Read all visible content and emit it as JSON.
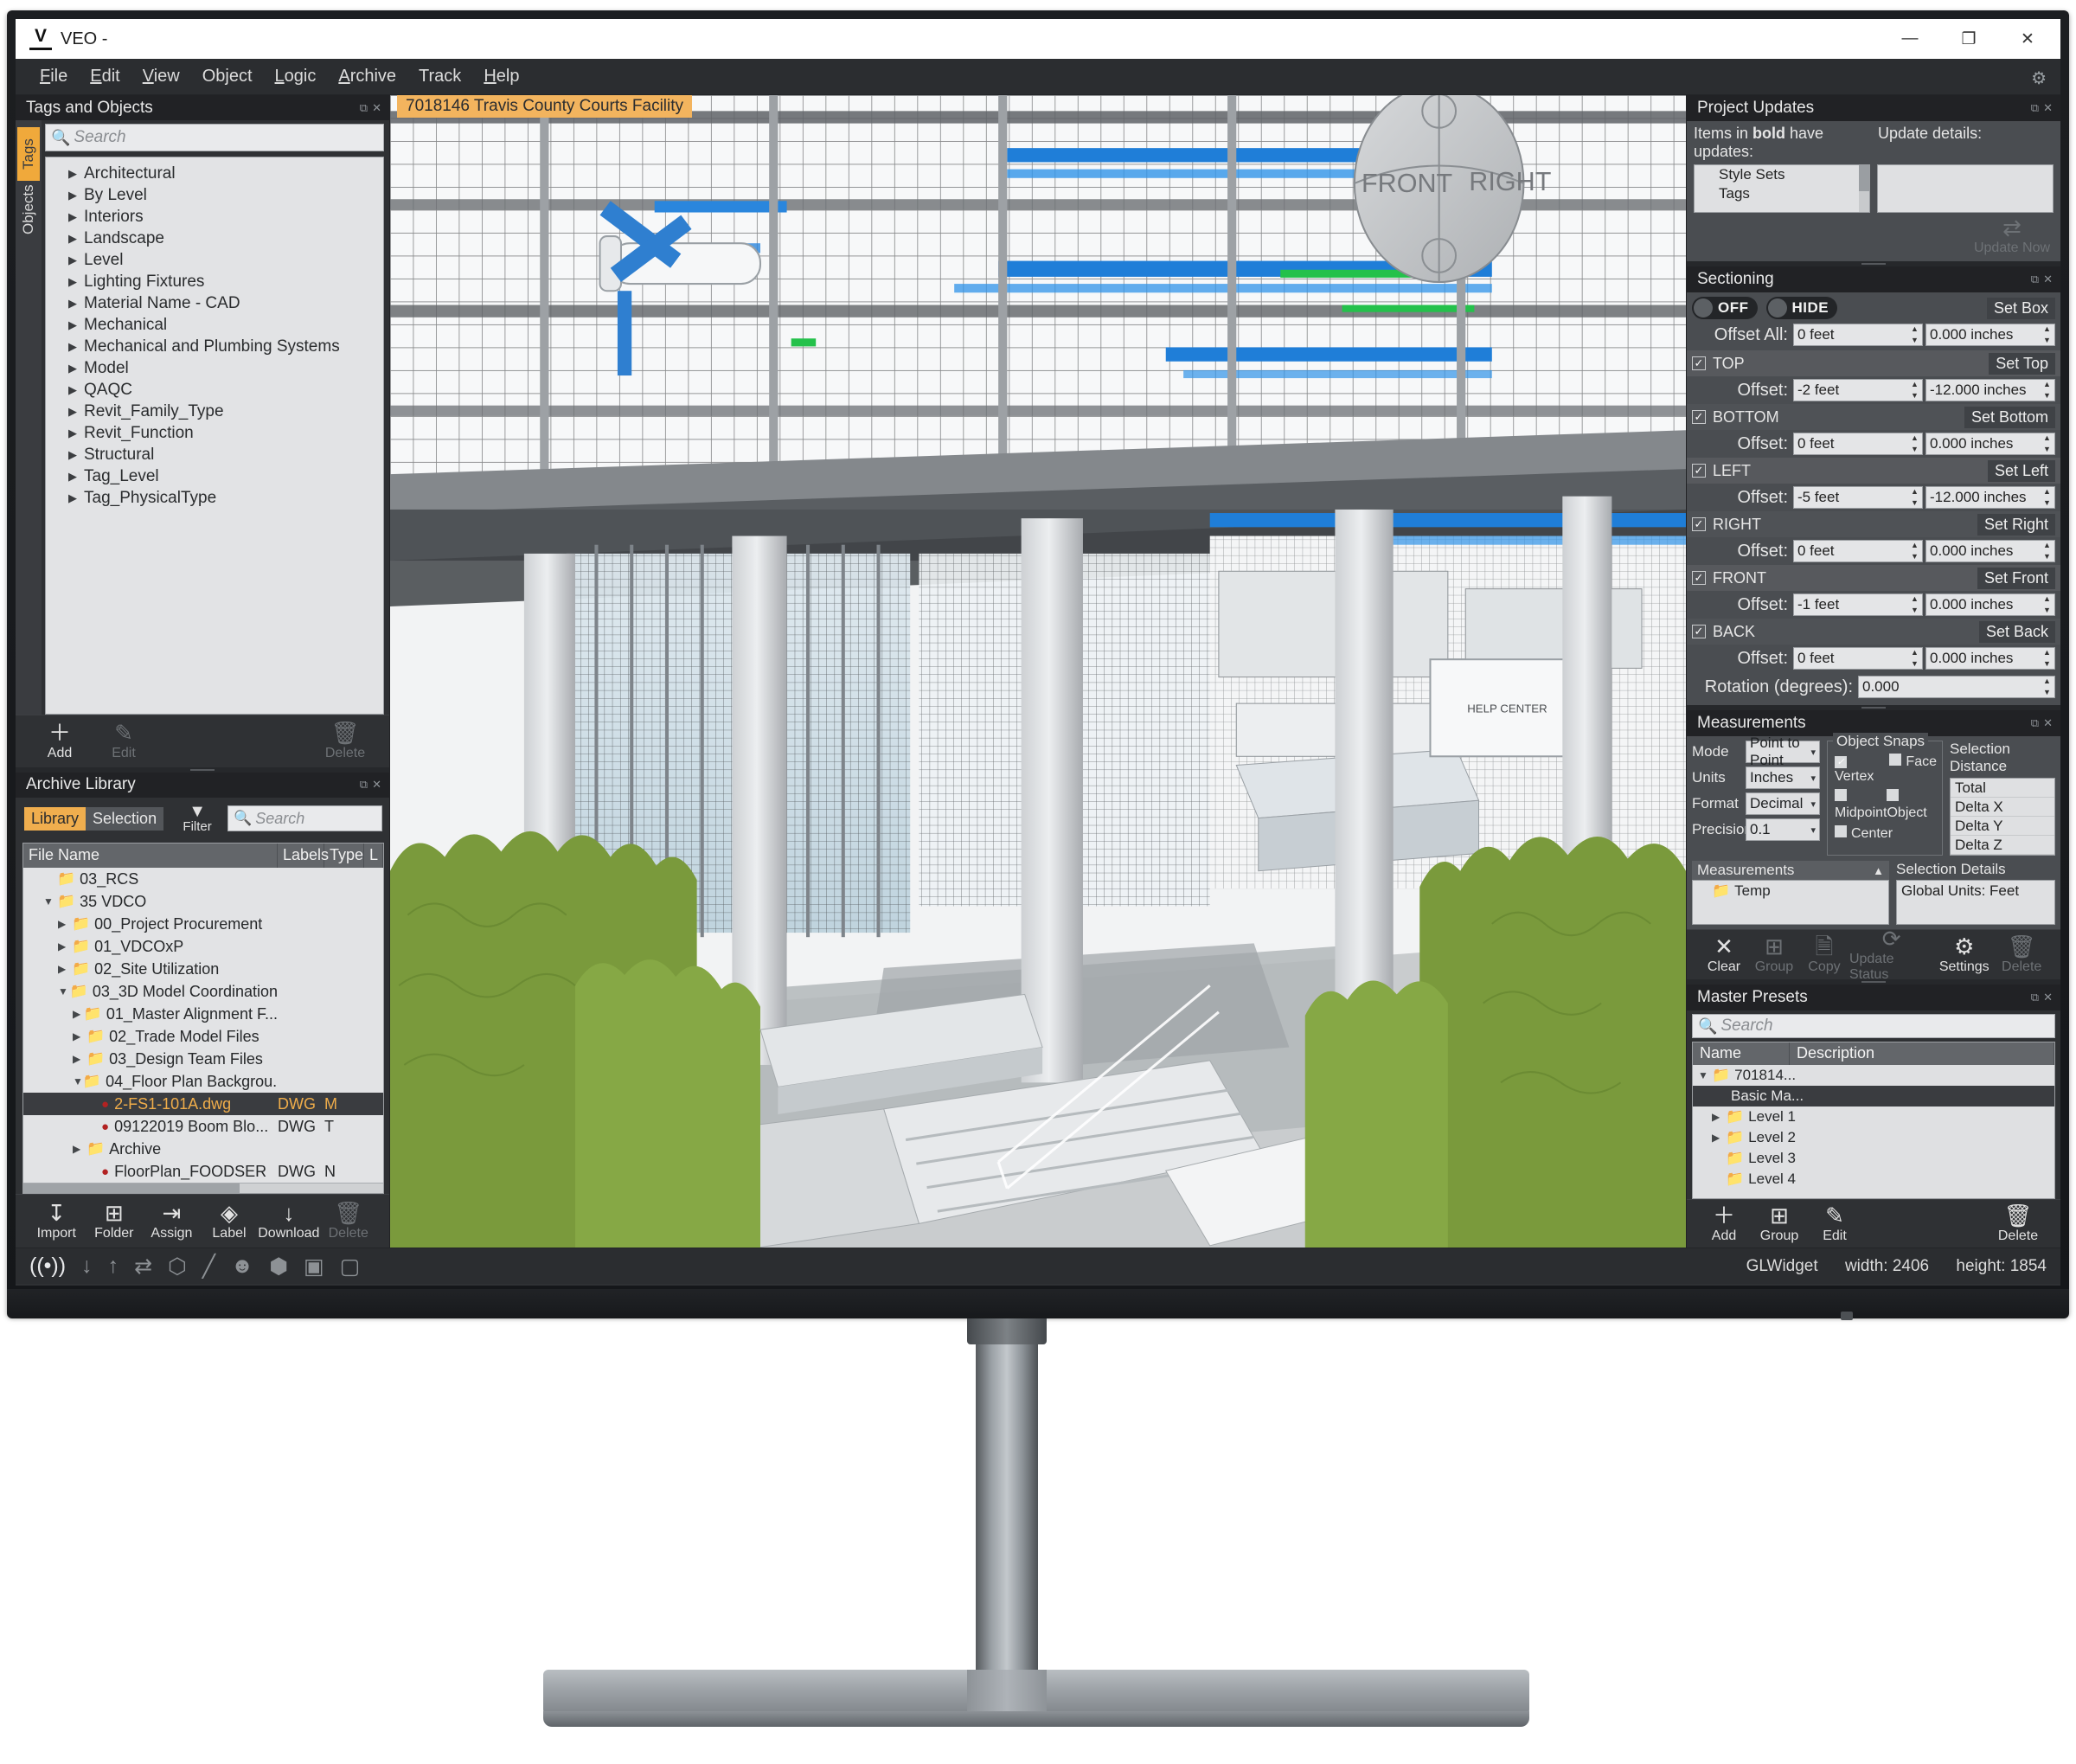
{
  "window": {
    "title": "VEO -",
    "logo": "V",
    "minimize": "—",
    "maximize": "❐",
    "close": "✕"
  },
  "menubar": {
    "items": [
      "File",
      "Edit",
      "View",
      "Object",
      "Logic",
      "Archive",
      "Track",
      "Help"
    ],
    "gear_icon": "gear-icon"
  },
  "tags_panel": {
    "title": "Tags and Objects",
    "dock_icons": [
      "⧉",
      "✕"
    ],
    "vtabs": [
      {
        "label": "Tags",
        "active": true
      },
      {
        "label": "Objects",
        "active": false
      }
    ],
    "search_placeholder": "Search",
    "tree": [
      "Architectural",
      "By Level",
      "Interiors",
      "Landscape",
      "Level",
      "Lighting Fixtures",
      "Material Name - CAD",
      "Mechanical",
      "Mechanical and Plumbing Systems",
      "Model",
      "QAQC",
      "Revit_Family_Type",
      "Revit_Function",
      "Structural",
      "Tag_Level",
      "Tag_PhysicalType"
    ],
    "toolbar": [
      {
        "icon": "plus-icon",
        "glyph": "＋",
        "label": "Add",
        "enabled": true
      },
      {
        "icon": "pencil-icon",
        "glyph": "✎",
        "label": "Edit",
        "enabled": false
      },
      {
        "icon": "trash-icon",
        "glyph": "🗑",
        "label": "Delete",
        "enabled": false
      }
    ]
  },
  "archive_panel": {
    "title": "Archive Library",
    "dock_icons": [
      "⧉",
      "✕"
    ],
    "tabs": [
      {
        "label": "Library",
        "active": true
      },
      {
        "label": "Selection",
        "active": false
      }
    ],
    "filter_label": "Filter",
    "filter_icon": "funnel-icon",
    "search_placeholder": "Search",
    "columns": [
      "File Name",
      "Labels",
      "Type",
      "L"
    ],
    "rows": [
      {
        "indent": 1,
        "arrow": "",
        "kind": "folder",
        "name": "03_RCS",
        "labels": "",
        "type": "",
        "selected": false
      },
      {
        "indent": 1,
        "arrow": "▼",
        "kind": "folder",
        "name": "35 VDCO",
        "labels": "",
        "type": "",
        "selected": false
      },
      {
        "indent": 2,
        "arrow": "▶",
        "kind": "folder",
        "name": "00_Project Procurement",
        "labels": "",
        "type": "",
        "selected": false
      },
      {
        "indent": 2,
        "arrow": "▶",
        "kind": "folder",
        "name": "01_VDCOxP",
        "labels": "",
        "type": "",
        "selected": false
      },
      {
        "indent": 2,
        "arrow": "▶",
        "kind": "folder",
        "name": "02_Site Utilization",
        "labels": "",
        "type": "",
        "selected": false
      },
      {
        "indent": 2,
        "arrow": "▼",
        "kind": "folder",
        "name": "03_3D Model Coordination",
        "labels": "",
        "type": "",
        "selected": false
      },
      {
        "indent": 3,
        "arrow": "▶",
        "kind": "folder",
        "name": "01_Master Alignment F...",
        "labels": "",
        "type": "",
        "selected": false
      },
      {
        "indent": 3,
        "arrow": "▶",
        "kind": "folder",
        "name": "02_Trade Model Files",
        "labels": "",
        "type": "",
        "selected": false
      },
      {
        "indent": 3,
        "arrow": "▶",
        "kind": "folder",
        "name": "03_Design Team Files",
        "labels": "",
        "type": "",
        "selected": false
      },
      {
        "indent": 3,
        "arrow": "▼",
        "kind": "folder",
        "name": "04_Floor Plan Backgrou...",
        "labels": "",
        "type": "",
        "selected": false
      },
      {
        "indent": 4,
        "arrow": "",
        "kind": "file",
        "name": "2-FS1-101A.dwg",
        "labels": "DWG",
        "type": "M",
        "selected": true
      },
      {
        "indent": 4,
        "arrow": "",
        "kind": "file",
        "name": "09122019 Boom Blo...",
        "labels": "DWG",
        "type": "T",
        "selected": false
      },
      {
        "indent": 3,
        "arrow": "▶",
        "kind": "folder",
        "name": "Archive",
        "labels": "",
        "type": "",
        "selected": false
      },
      {
        "indent": 4,
        "arrow": "",
        "kind": "file",
        "name": "FloorPlan_FOODSER",
        "labels": "DWG",
        "type": "N",
        "selected": false
      }
    ],
    "toolbar": [
      {
        "icon": "import-icon",
        "glyph": "↧",
        "label": "Import",
        "enabled": true
      },
      {
        "icon": "new-folder-icon",
        "glyph": "➕",
        "label": "Folder",
        "enabled": true
      },
      {
        "icon": "assign-icon",
        "glyph": "↱",
        "label": "Assign",
        "enabled": true
      },
      {
        "icon": "label-tag-icon",
        "glyph": "◆",
        "label": "Label",
        "enabled": true
      },
      {
        "icon": "download-icon",
        "glyph": "↓",
        "label": "Download",
        "enabled": true
      },
      {
        "icon": "trash-icon",
        "glyph": "🗑",
        "label": "Delete",
        "enabled": false
      }
    ]
  },
  "viewport": {
    "tab_label": "7018146 Travis County Courts Facility",
    "view_cube": {
      "front": "FRONT",
      "right": "RIGHT"
    },
    "scene_label": "HELP CENTER"
  },
  "project_updates": {
    "title": "Project Updates",
    "dock_icons": [
      "⧉",
      "✕"
    ],
    "items_label_pre": "Items in ",
    "items_label_bold": "bold",
    "items_label_post": " have updates:",
    "details_label": "Update details:",
    "items": [
      "Style Sets",
      "Tags"
    ],
    "details_text": "",
    "update_now_label": "Update Now",
    "update_now_icon": "refresh-icon"
  },
  "sectioning": {
    "title": "Sectioning",
    "dock_icons": [
      "⧉",
      "✕"
    ],
    "toggles": [
      {
        "label": "OFF",
        "name": "sectioning-off-toggle"
      },
      {
        "label": "HIDE",
        "name": "sectioning-hide-toggle"
      }
    ],
    "set_box_label": "Set Box",
    "offset_all_label": "Offset All:",
    "offset_all_feet": "0 feet",
    "offset_all_inches": "0.000 inches",
    "offset_label": "Offset:",
    "planes": [
      {
        "name": "TOP",
        "checked": true,
        "set_label": "Set Top",
        "feet": "-2 feet",
        "inches": "-12.000 inches"
      },
      {
        "name": "BOTTOM",
        "checked": true,
        "set_label": "Set Bottom",
        "feet": "0 feet",
        "inches": "0.000 inches"
      },
      {
        "name": "LEFT",
        "checked": true,
        "set_label": "Set Left",
        "feet": "-5 feet",
        "inches": "-12.000 inches"
      },
      {
        "name": "RIGHT",
        "checked": true,
        "set_label": "Set Right",
        "feet": "0 feet",
        "inches": "0.000 inches"
      },
      {
        "name": "FRONT",
        "checked": true,
        "set_label": "Set Front",
        "feet": "-1 feet",
        "inches": "0.000 inches"
      },
      {
        "name": "BACK",
        "checked": true,
        "set_label": "Set Back",
        "feet": "0 feet",
        "inches": "0.000 inches"
      }
    ],
    "rotation_label": "Rotation (degrees):",
    "rotation_value": "0.000"
  },
  "measurements": {
    "title": "Measurements",
    "dock_icons": [
      "⧉",
      "✕"
    ],
    "fields": [
      {
        "label": "Mode",
        "value": "Point to Point"
      },
      {
        "label": "Units",
        "value": "Inches"
      },
      {
        "label": "Format",
        "value": "Decimal"
      },
      {
        "label": "Precision",
        "value": "0.1"
      }
    ],
    "object_snaps_label": "Object Snaps",
    "snaps": [
      {
        "label": "Vertex",
        "checked": true
      },
      {
        "label": "Face",
        "checked": false
      },
      {
        "label": "Midpoint",
        "checked": false
      },
      {
        "label": "Object",
        "checked": false
      },
      {
        "label": "Center",
        "checked": false
      }
    ],
    "selection_distance_label": "Selection Distance",
    "distance_rows": [
      "Total",
      "Delta X",
      "Delta Y",
      "Delta Z"
    ],
    "list_title": "Measurements",
    "list_items": [
      "Temp"
    ],
    "selection_details_label": "Selection Details",
    "selection_details_value": "Global Units: Feet",
    "toolbar": [
      {
        "icon": "close-x-icon",
        "glyph": "✕",
        "label": "Clear",
        "enabled": true
      },
      {
        "icon": "group-icon",
        "glyph": "➕",
        "label": "Group",
        "enabled": false
      },
      {
        "icon": "copy-icon",
        "glyph": "❐",
        "label": "Copy",
        "enabled": false
      },
      {
        "icon": "refresh-icon",
        "glyph": "⟳",
        "label": "Update Status",
        "enabled": false
      },
      {
        "icon": "gear-icon",
        "glyph": "⚙",
        "label": "Settings",
        "enabled": true
      },
      {
        "icon": "trash-icon",
        "glyph": "🗑",
        "label": "Delete",
        "enabled": false
      }
    ]
  },
  "master_presets": {
    "title": "Master Presets",
    "dock_icons": [
      "⧉",
      "✕"
    ],
    "search_placeholder": "Search",
    "columns": [
      "Name",
      "Description"
    ],
    "rows": [
      {
        "indent": 0,
        "arrow": "▼",
        "kind": "folder",
        "name": "701814...",
        "selected": false
      },
      {
        "indent": 1,
        "arrow": "",
        "kind": "item",
        "name": "Basic Ma...",
        "selected": true
      },
      {
        "indent": 1,
        "arrow": "▶",
        "kind": "folder",
        "name": "Level 1",
        "selected": false
      },
      {
        "indent": 1,
        "arrow": "▶",
        "kind": "folder",
        "name": "Level 2",
        "selected": false
      },
      {
        "indent": 1,
        "arrow": "",
        "kind": "folder",
        "name": "Level 3",
        "selected": false
      },
      {
        "indent": 1,
        "arrow": "",
        "kind": "folder",
        "name": "Level 4",
        "selected": false
      }
    ],
    "toolbar": [
      {
        "icon": "plus-icon",
        "glyph": "＋",
        "label": "Add",
        "enabled": true
      },
      {
        "icon": "new-folder-icon",
        "glyph": "➕",
        "label": "Group",
        "enabled": true
      },
      {
        "icon": "pencil-icon",
        "glyph": "✎",
        "label": "Edit",
        "enabled": true
      },
      {
        "icon": "trash-icon",
        "glyph": "🗑",
        "label": "Delete",
        "enabled": true
      }
    ]
  },
  "statusbar": {
    "icons": [
      {
        "name": "broadcast-icon",
        "glyph": "((•))",
        "active": true
      },
      {
        "name": "download-icon",
        "glyph": "↓",
        "active": false
      },
      {
        "name": "upload-icon",
        "glyph": "↑",
        "active": false
      },
      {
        "name": "sync-icon",
        "glyph": "⇆",
        "active": false
      },
      {
        "name": "cube-wire-icon",
        "glyph": "⬡",
        "active": false
      },
      {
        "name": "ruler-icon",
        "glyph": "╱",
        "active": false
      },
      {
        "name": "person-icon",
        "glyph": "☻",
        "active": false
      },
      {
        "name": "cube-solid-icon",
        "glyph": "⬢",
        "active": false
      },
      {
        "name": "camera-icon",
        "glyph": "▣",
        "active": false
      },
      {
        "name": "folder-sync-icon",
        "glyph": "▢",
        "active": false
      }
    ],
    "gl_label": "GLWidget",
    "width_label": "width: 2406",
    "height_label": "height: 1854"
  },
  "colors": {
    "accent": "#f0ae4e",
    "panel_bg": "#2f3134",
    "panel_header": "#212225",
    "field_bg": "#e2e3e5",
    "section_bg": "#4a4d51"
  }
}
